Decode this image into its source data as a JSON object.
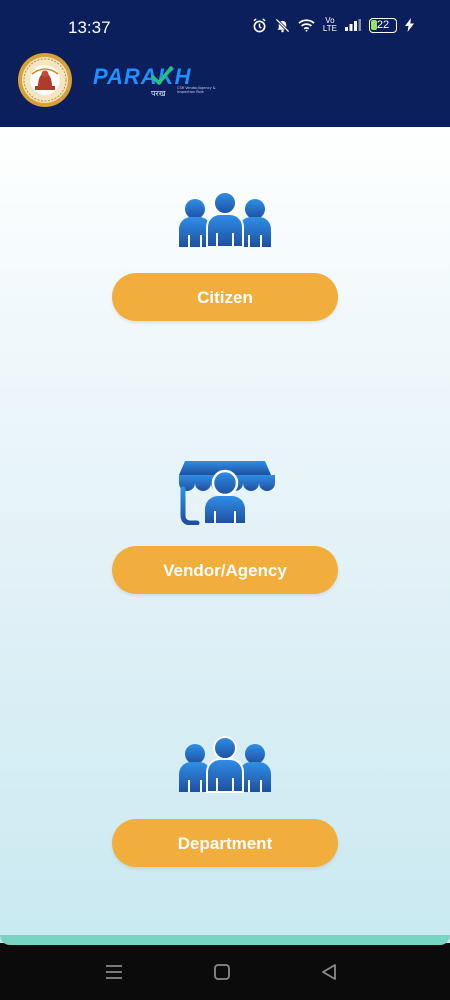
{
  "status_bar": {
    "time": "13:37",
    "network_label": "Vo\nLTE",
    "battery_level": "22",
    "icons": [
      "alarm-icon",
      "mute-icon",
      "wifi-icon",
      "volte-icon",
      "signal-icon",
      "battery-icon",
      "charging-icon"
    ]
  },
  "header": {
    "logo_text": "PARAKH",
    "logo_hindi": "परख",
    "logo_tagline": "CSR Vendor/Agency & Inspection Role",
    "emblem_icon": "state-emblem-icon",
    "colors": {
      "header_bg": "#0a1f5c",
      "logo_blue": "#1e90ff",
      "logo_check": "#27c27a"
    }
  },
  "roles": [
    {
      "label": "Citizen",
      "icon": "citizen-group-icon"
    },
    {
      "label": "Vendor/Agency",
      "icon": "vendor-stall-icon"
    },
    {
      "label": "Department",
      "icon": "department-group-icon"
    }
  ],
  "colors": {
    "button": "#f2ae3c",
    "icon_blue_top": "#2f8fe6",
    "icon_blue_bottom": "#1e4fa0"
  },
  "nav_bar": {
    "icons": [
      "menu-icon",
      "home-icon",
      "back-icon"
    ]
  }
}
